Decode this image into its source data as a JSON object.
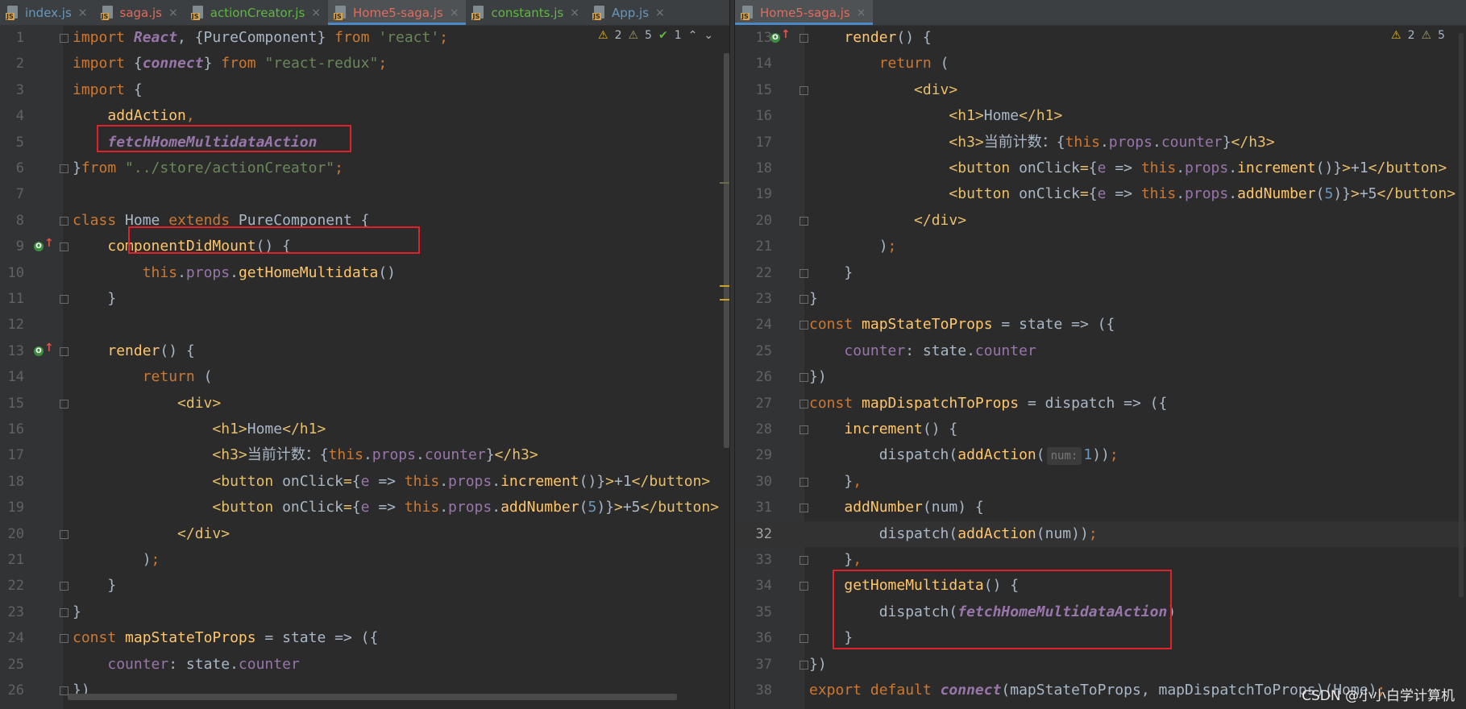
{
  "left_pane": {
    "tabs": [
      {
        "label": "index.js",
        "color": "blue"
      },
      {
        "label": "saga.js",
        "color": "red"
      },
      {
        "label": "actionCreator.js",
        "color": "green"
      },
      {
        "label": "Home5-saga.js",
        "color": "red",
        "active": true
      },
      {
        "label": "constants.js",
        "color": "green"
      },
      {
        "label": "App.js",
        "color": "blue"
      }
    ],
    "inspection": {
      "warnings_a": "2",
      "warnings_b": "5",
      "ok": "1"
    },
    "lines": [
      {
        "n": "1",
        "tokens": [
          [
            "kw",
            "import "
          ],
          [
            "it",
            "React"
          ],
          [
            "plain",
            ", {PureComponent} "
          ],
          [
            "kw",
            "from "
          ],
          [
            "str",
            "'react'"
          ],
          [
            "kw",
            ";"
          ]
        ]
      },
      {
        "n": "2",
        "tokens": [
          [
            "kw",
            "import "
          ],
          [
            "plain",
            "{"
          ],
          [
            "it",
            "connect"
          ],
          [
            "plain",
            "} "
          ],
          [
            "kw",
            "from "
          ],
          [
            "str",
            "\"react-redux\""
          ],
          [
            "kw",
            ";"
          ]
        ]
      },
      {
        "n": "3",
        "tokens": [
          [
            "kw",
            "import "
          ],
          [
            "plain",
            "{"
          ]
        ]
      },
      {
        "n": "4",
        "tokens": [
          [
            "plain",
            "    "
          ],
          [
            "fn",
            "addAction"
          ],
          [
            "kw",
            ","
          ]
        ]
      },
      {
        "n": "5",
        "tokens": [
          [
            "plain",
            "    "
          ],
          [
            "it",
            "fetchHomeMultidataAction"
          ]
        ]
      },
      {
        "n": "6",
        "tokens": [
          [
            "plain",
            "}"
          ],
          [
            "kw",
            "from "
          ],
          [
            "str",
            "\"../store/actionCreator\""
          ],
          [
            "kw",
            ";"
          ]
        ]
      },
      {
        "n": "7",
        "tokens": []
      },
      {
        "n": "8",
        "tokens": [
          [
            "kw",
            "class "
          ],
          [
            "plain",
            "Home "
          ],
          [
            "kw",
            "extends "
          ],
          [
            "plain",
            "PureComponent {"
          ]
        ]
      },
      {
        "n": "9",
        "tokens": [
          [
            "plain",
            "    "
          ],
          [
            "fn",
            "componentDidMount"
          ],
          [
            "plain",
            "() {"
          ]
        ]
      },
      {
        "n": "10",
        "tokens": [
          [
            "plain",
            "        "
          ],
          [
            "kw",
            "this"
          ],
          [
            "plain",
            "."
          ],
          [
            "prop",
            "props"
          ],
          [
            "plain",
            "."
          ],
          [
            "fn",
            "getHomeMultidata"
          ],
          [
            "plain",
            "()"
          ]
        ]
      },
      {
        "n": "11",
        "tokens": [
          [
            "plain",
            "    }"
          ]
        ]
      },
      {
        "n": "12",
        "tokens": []
      },
      {
        "n": "13",
        "tokens": [
          [
            "plain",
            "    "
          ],
          [
            "fn",
            "render"
          ],
          [
            "plain",
            "() {"
          ]
        ]
      },
      {
        "n": "14",
        "tokens": [
          [
            "plain",
            "        "
          ],
          [
            "kw",
            "return "
          ],
          [
            "plain",
            "("
          ]
        ]
      },
      {
        "n": "15",
        "tokens": [
          [
            "plain",
            "            "
          ],
          [
            "tag",
            "<div>"
          ]
        ]
      },
      {
        "n": "16",
        "tokens": [
          [
            "plain",
            "                "
          ],
          [
            "tag",
            "<h1>"
          ],
          [
            "plain",
            "Home"
          ],
          [
            "tag",
            "</h1>"
          ]
        ]
      },
      {
        "n": "17",
        "tokens": [
          [
            "plain",
            "                "
          ],
          [
            "tag",
            "<h3>"
          ],
          [
            "plain",
            "当前计数："
          ],
          [
            "plain",
            "{"
          ],
          [
            "kw",
            "this"
          ],
          [
            "plain",
            "."
          ],
          [
            "prop",
            "props"
          ],
          [
            "plain",
            "."
          ],
          [
            "prop",
            "counter"
          ],
          [
            "plain",
            "}"
          ],
          [
            "tag",
            "</h3>"
          ]
        ]
      },
      {
        "n": "18",
        "tokens": [
          [
            "plain",
            "                "
          ],
          [
            "tag",
            "<button "
          ],
          [
            "plain",
            "onClick"
          ],
          [
            "tag",
            "="
          ],
          [
            "plain",
            "{"
          ],
          [
            "prop",
            "e"
          ],
          [
            "plain",
            " => "
          ],
          [
            "kw",
            "this"
          ],
          [
            "plain",
            "."
          ],
          [
            "prop",
            "props"
          ],
          [
            "plain",
            "."
          ],
          [
            "fn",
            "increment"
          ],
          [
            "plain",
            "()}"
          ],
          [
            "tag",
            ">"
          ],
          [
            "plain",
            "+1"
          ],
          [
            "tag",
            "</button>"
          ]
        ]
      },
      {
        "n": "19",
        "tokens": [
          [
            "plain",
            "                "
          ],
          [
            "tag",
            "<button "
          ],
          [
            "plain",
            "onClick"
          ],
          [
            "tag",
            "="
          ],
          [
            "plain",
            "{"
          ],
          [
            "prop",
            "e"
          ],
          [
            "plain",
            " => "
          ],
          [
            "kw",
            "this"
          ],
          [
            "plain",
            "."
          ],
          [
            "prop",
            "props"
          ],
          [
            "plain",
            "."
          ],
          [
            "fn",
            "addNumber"
          ],
          [
            "plain",
            "("
          ],
          [
            "num",
            "5"
          ],
          [
            "plain",
            ")}"
          ],
          [
            "tag",
            ">"
          ],
          [
            "plain",
            "+5"
          ],
          [
            "tag",
            "</button>"
          ]
        ]
      },
      {
        "n": "20",
        "tokens": [
          [
            "plain",
            "            "
          ],
          [
            "tag",
            "</div>"
          ]
        ]
      },
      {
        "n": "21",
        "tokens": [
          [
            "plain",
            "        )"
          ],
          [
            "kw",
            ";"
          ]
        ]
      },
      {
        "n": "22",
        "tokens": [
          [
            "plain",
            "    }"
          ]
        ]
      },
      {
        "n": "23",
        "tokens": [
          [
            "plain",
            "}"
          ]
        ]
      },
      {
        "n": "24",
        "tokens": [
          [
            "kw",
            "const "
          ],
          [
            "fn",
            "mapStateToProps"
          ],
          [
            "plain",
            " = state => ({"
          ]
        ]
      },
      {
        "n": "25",
        "tokens": [
          [
            "plain",
            "    "
          ],
          [
            "prop",
            "counter"
          ],
          [
            "plain",
            ": state."
          ],
          [
            "prop",
            "counter"
          ]
        ]
      },
      {
        "n": "26",
        "tokens": [
          [
            "plain",
            "})"
          ]
        ]
      }
    ]
  },
  "right_pane": {
    "tabs": [
      {
        "label": "Home5-saga.js",
        "color": "red",
        "active": true
      }
    ],
    "inspection": {
      "warnings_a": "2",
      "warnings_b": "5"
    },
    "lines": [
      {
        "n": "13",
        "tokens": [
          [
            "plain",
            "    "
          ],
          [
            "fn",
            "render"
          ],
          [
            "plain",
            "() {"
          ]
        ]
      },
      {
        "n": "14",
        "tokens": [
          [
            "plain",
            "        "
          ],
          [
            "kw",
            "return "
          ],
          [
            "plain",
            "("
          ]
        ]
      },
      {
        "n": "15",
        "tokens": [
          [
            "plain",
            "            "
          ],
          [
            "tag",
            "<div>"
          ]
        ]
      },
      {
        "n": "16",
        "tokens": [
          [
            "plain",
            "                "
          ],
          [
            "tag",
            "<h1>"
          ],
          [
            "plain",
            "Home"
          ],
          [
            "tag",
            "</h1>"
          ]
        ]
      },
      {
        "n": "17",
        "tokens": [
          [
            "plain",
            "                "
          ],
          [
            "tag",
            "<h3>"
          ],
          [
            "plain",
            "当前计数："
          ],
          [
            "plain",
            "{"
          ],
          [
            "kw",
            "this"
          ],
          [
            "plain",
            "."
          ],
          [
            "prop",
            "props"
          ],
          [
            "plain",
            "."
          ],
          [
            "prop",
            "counter"
          ],
          [
            "plain",
            "}"
          ],
          [
            "tag",
            "</h3>"
          ]
        ]
      },
      {
        "n": "18",
        "tokens": [
          [
            "plain",
            "                "
          ],
          [
            "tag",
            "<button "
          ],
          [
            "plain",
            "onClick"
          ],
          [
            "tag",
            "="
          ],
          [
            "plain",
            "{"
          ],
          [
            "prop",
            "e"
          ],
          [
            "plain",
            " => "
          ],
          [
            "kw",
            "this"
          ],
          [
            "plain",
            "."
          ],
          [
            "prop",
            "props"
          ],
          [
            "plain",
            "."
          ],
          [
            "fn",
            "increment"
          ],
          [
            "plain",
            "()}"
          ],
          [
            "tag",
            ">"
          ],
          [
            "plain",
            "+1"
          ],
          [
            "tag",
            "</button>"
          ]
        ]
      },
      {
        "n": "19",
        "tokens": [
          [
            "plain",
            "                "
          ],
          [
            "tag",
            "<button "
          ],
          [
            "plain",
            "onClick"
          ],
          [
            "tag",
            "="
          ],
          [
            "plain",
            "{"
          ],
          [
            "prop",
            "e"
          ],
          [
            "plain",
            " => "
          ],
          [
            "kw",
            "this"
          ],
          [
            "plain",
            "."
          ],
          [
            "prop",
            "props"
          ],
          [
            "plain",
            "."
          ],
          [
            "fn",
            "addNumber"
          ],
          [
            "plain",
            "("
          ],
          [
            "num",
            "5"
          ],
          [
            "plain",
            ")}"
          ],
          [
            "tag",
            ">"
          ],
          [
            "plain",
            "+5"
          ],
          [
            "tag",
            "</button>"
          ]
        ]
      },
      {
        "n": "20",
        "tokens": [
          [
            "plain",
            "            "
          ],
          [
            "tag",
            "</div>"
          ]
        ]
      },
      {
        "n": "21",
        "tokens": [
          [
            "plain",
            "        )"
          ],
          [
            "kw",
            ";"
          ]
        ]
      },
      {
        "n": "22",
        "tokens": [
          [
            "plain",
            "    }"
          ]
        ]
      },
      {
        "n": "23",
        "tokens": [
          [
            "plain",
            "}"
          ]
        ]
      },
      {
        "n": "24",
        "tokens": [
          [
            "kw",
            "const "
          ],
          [
            "fn",
            "mapStateToProps"
          ],
          [
            "plain",
            " = state => ({"
          ]
        ]
      },
      {
        "n": "25",
        "tokens": [
          [
            "plain",
            "    "
          ],
          [
            "prop",
            "counter"
          ],
          [
            "plain",
            ": state."
          ],
          [
            "prop",
            "counter"
          ]
        ]
      },
      {
        "n": "26",
        "tokens": [
          [
            "plain",
            "})"
          ]
        ]
      },
      {
        "n": "27",
        "tokens": [
          [
            "kw",
            "const "
          ],
          [
            "fn",
            "mapDispatchToProps"
          ],
          [
            "plain",
            " = dispatch => ({"
          ]
        ]
      },
      {
        "n": "28",
        "tokens": [
          [
            "plain",
            "    "
          ],
          [
            "fn",
            "increment"
          ],
          [
            "plain",
            "() {"
          ]
        ]
      },
      {
        "n": "29",
        "tokens": [
          [
            "plain",
            "        dispatch("
          ],
          [
            "fn",
            "addAction"
          ],
          [
            "plain",
            "("
          ],
          [
            "hint",
            "num:"
          ],
          [
            "num",
            "1"
          ],
          [
            "plain",
            "))"
          ],
          [
            "kw",
            ";"
          ]
        ]
      },
      {
        "n": "30",
        "tokens": [
          [
            "plain",
            "    }"
          ],
          [
            "kw",
            ","
          ]
        ]
      },
      {
        "n": "31",
        "tokens": [
          [
            "plain",
            "    "
          ],
          [
            "fn",
            "addNumber"
          ],
          [
            "plain",
            "(num) {"
          ]
        ]
      },
      {
        "n": "32",
        "tokens": [
          [
            "plain",
            "        dispatch("
          ],
          [
            "fn",
            "addAction"
          ],
          [
            "plain",
            "(num))"
          ],
          [
            "kw",
            ";"
          ]
        ],
        "current": true
      },
      {
        "n": "33",
        "tokens": [
          [
            "plain",
            "    }"
          ],
          [
            "kw",
            ","
          ]
        ]
      },
      {
        "n": "34",
        "tokens": [
          [
            "plain",
            "    "
          ],
          [
            "fn",
            "getHomeMultidata"
          ],
          [
            "plain",
            "() {"
          ]
        ]
      },
      {
        "n": "35",
        "tokens": [
          [
            "plain",
            "        dispatch("
          ],
          [
            "it",
            "fetchHomeMultidataAction"
          ],
          [
            "plain",
            ")"
          ]
        ]
      },
      {
        "n": "36",
        "tokens": [
          [
            "plain",
            "    }"
          ]
        ]
      },
      {
        "n": "37",
        "tokens": [
          [
            "plain",
            "})"
          ]
        ]
      },
      {
        "n": "38",
        "tokens": [
          [
            "kw",
            "export default "
          ],
          [
            "it",
            "connect"
          ],
          [
            "plain",
            "(mapStateToProps, mapDispatchToProps)(Home)"
          ],
          [
            "kw",
            ";"
          ]
        ]
      }
    ]
  },
  "watermark": "CSDN @小小白学计算机",
  "colors": {
    "keyword": "#cc7832",
    "string": "#6a8759",
    "function": "#ffc66d",
    "property": "#9876aa",
    "number": "#6897bb",
    "tag": "#e8bf6a",
    "text": "#a9b7c6",
    "highlight_box": "#e0202a"
  }
}
